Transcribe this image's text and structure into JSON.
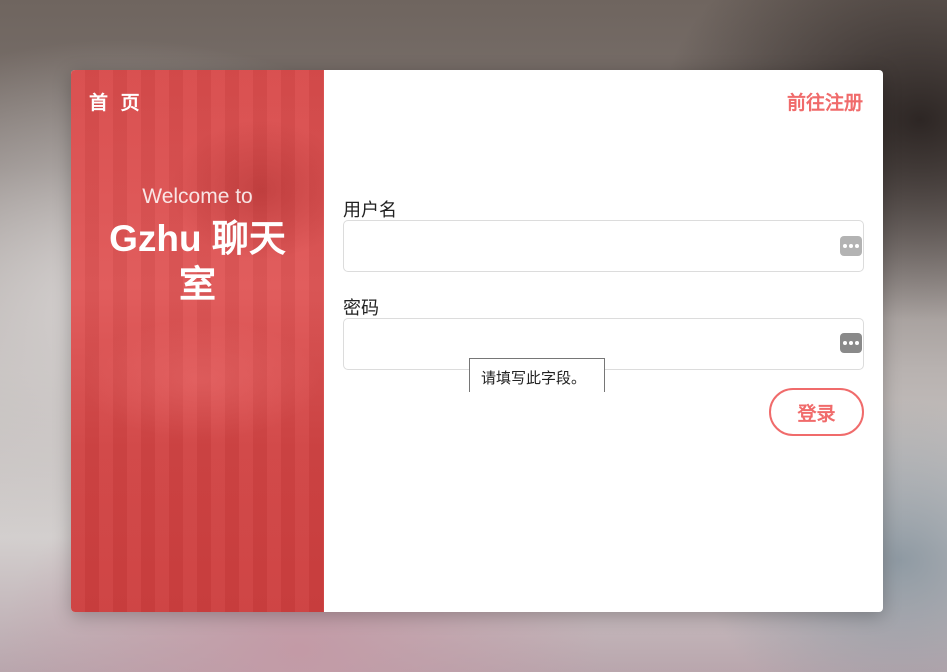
{
  "nav": {
    "home_label": "首 页",
    "register_label": "前往注册"
  },
  "hero": {
    "welcome": "Welcome to",
    "title": "Gzhu 聊天室"
  },
  "form": {
    "username_label": "用户名",
    "username_value": "",
    "password_label": "密码",
    "password_value": "",
    "validation_tooltip": "请填写此字段。",
    "login_label": "登录"
  },
  "icons": {
    "password_manager": "password-key-icon"
  },
  "colors": {
    "accent": "#f06b6b",
    "panel": "#dc4f4f"
  }
}
